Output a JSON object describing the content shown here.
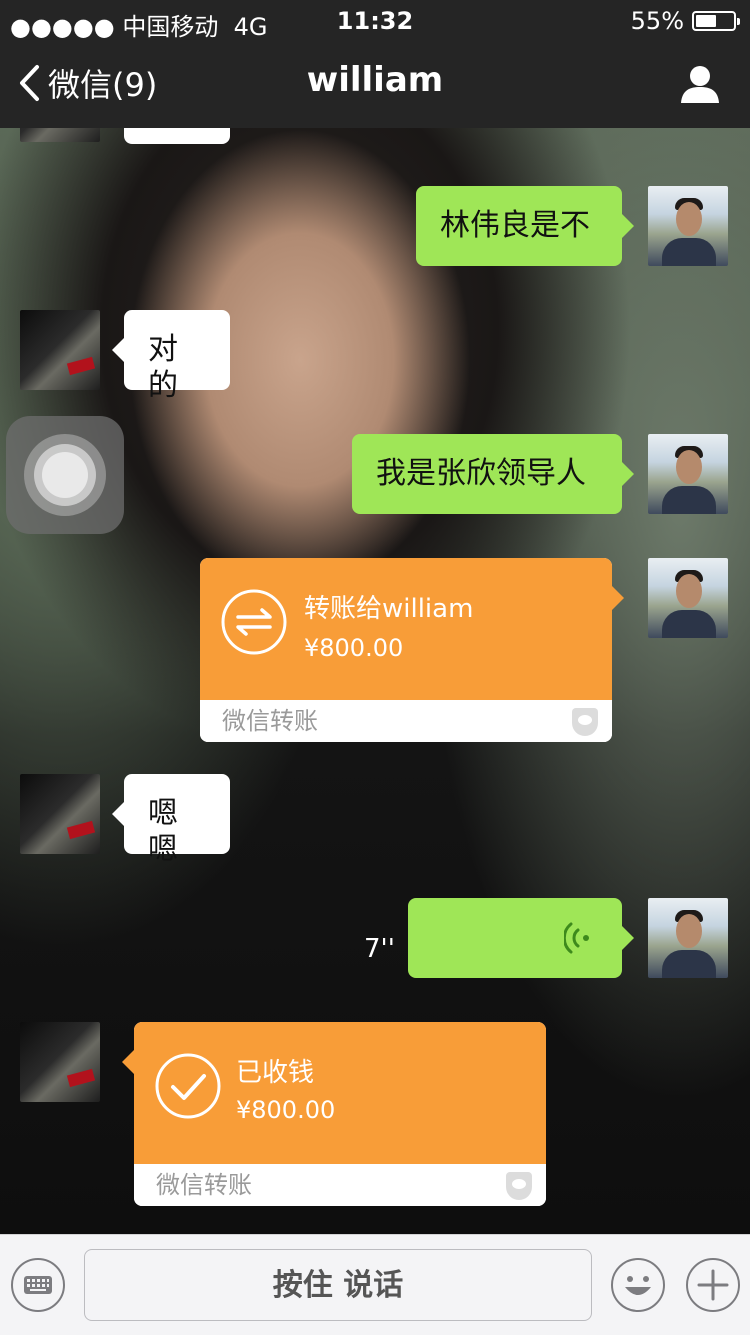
{
  "status_bar": {
    "carrier": "●●●●● 中国移动",
    "network": "4G",
    "time": "11:32",
    "battery": "55%",
    "battery_level": 0.55
  },
  "nav": {
    "back_label": "微信(9)",
    "title": "william",
    "profile_icon": "person-icon"
  },
  "messages": [
    {
      "side": "right",
      "type": "text",
      "text": "林伟良是不"
    },
    {
      "side": "left",
      "type": "text",
      "text": "对的"
    },
    {
      "side": "right",
      "type": "text",
      "text": "我是张欣领导人"
    },
    {
      "side": "right",
      "type": "transfer",
      "title": "转账给william",
      "amount": "¥800.00",
      "footer": "微信转账"
    },
    {
      "side": "left",
      "type": "text",
      "text": "嗯嗯"
    },
    {
      "side": "right",
      "type": "voice",
      "duration": "7''"
    },
    {
      "side": "left",
      "type": "transfer",
      "title": "已收钱",
      "amount": "¥800.00",
      "footer": "微信转账"
    }
  ],
  "input_bar": {
    "hold_to_talk": "按住 说话",
    "keyboard_icon": "keyboard-icon",
    "emoji_icon": "emoji-icon",
    "plus_icon": "plus-icon"
  },
  "colors": {
    "green_bubble": "#9fe657",
    "transfer_orange": "#f89d38",
    "nav_bg": "#252525"
  }
}
